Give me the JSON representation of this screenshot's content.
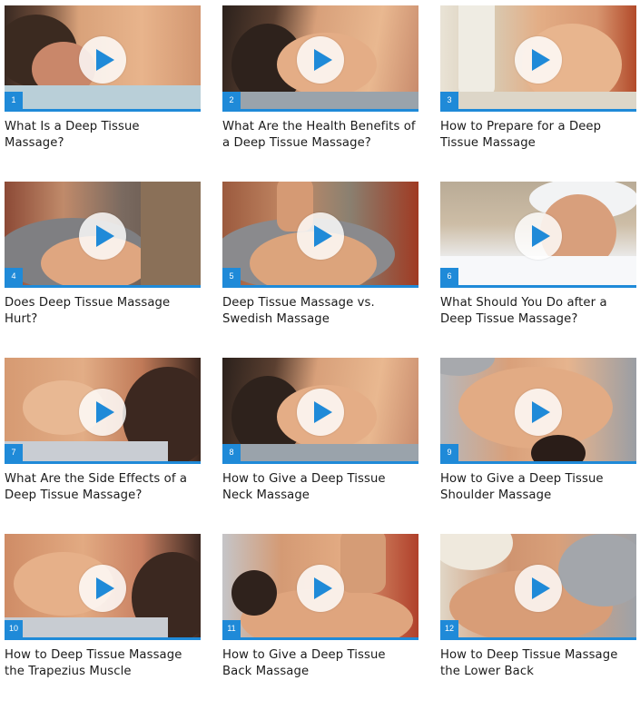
{
  "accent_color": "#1f8ad8",
  "videos": [
    {
      "number": "1",
      "title": "What Is a Deep Tissue Massage?",
      "thumbnail": "massage-neck-side"
    },
    {
      "number": "2",
      "title": "What Are the Health Benefits of a Deep Tissue Massage?",
      "thumbnail": "massage-neck-hands"
    },
    {
      "number": "3",
      "title": "How to Prepare for a Deep Tissue Massage",
      "thumbnail": "massage-face"
    },
    {
      "number": "4",
      "title": "Does Deep Tissue Massage Hurt?",
      "thumbnail": "massage-elbow-back"
    },
    {
      "number": "5",
      "title": "Deep Tissue Massage vs. Swedish Massage",
      "thumbnail": "massage-back-hand"
    },
    {
      "number": "6",
      "title": "What Should You Do after a Deep Tissue Massage?",
      "thumbnail": "woman-bath-towel"
    },
    {
      "number": "7",
      "title": "What Are the Side Effects of a Deep Tissue Massage?",
      "thumbnail": "massage-shoulder"
    },
    {
      "number": "8",
      "title": "How to Give a Deep Tissue Neck Massage",
      "thumbnail": "massage-neck-hands"
    },
    {
      "number": "9",
      "title": "How to Give a Deep Tissue Shoulder Massage",
      "thumbnail": "massage-shoulder-top"
    },
    {
      "number": "10",
      "title": "How to Deep Tissue Massage the Trapezius Muscle",
      "thumbnail": "massage-trapezius"
    },
    {
      "number": "11",
      "title": "How to Give a Deep Tissue Back Massage",
      "thumbnail": "massage-back-arm"
    },
    {
      "number": "12",
      "title": "How to Deep Tissue Massage the Lower Back",
      "thumbnail": "massage-lower-back"
    }
  ]
}
